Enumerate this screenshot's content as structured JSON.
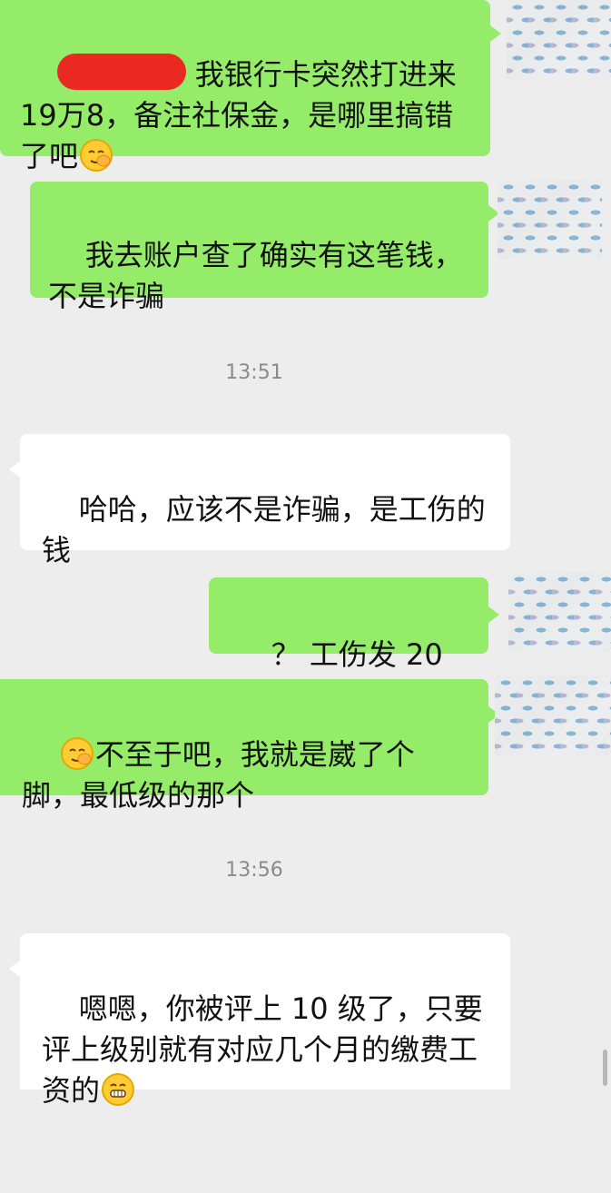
{
  "messages": [
    {
      "side": "out",
      "text_before": "",
      "text": "我银行卡突然打进来19万8，备注社保金，是哪里搞错了吧",
      "emoji": "facepalm-emoji"
    },
    {
      "side": "out",
      "text": "我去账户查了确实有这笔钱，不是诈骗"
    },
    {
      "type": "time",
      "text": "13:51"
    },
    {
      "side": "in",
      "text": "哈哈，应该不是诈骗，是工伤的钱"
    },
    {
      "side": "out",
      "text": "？ 工伤发 20 万？"
    },
    {
      "side": "out",
      "emoji_before": "facepalm-emoji",
      "text": "不至于吧，我就是崴了个脚，最低级的那个"
    },
    {
      "type": "time",
      "text": "13:56"
    },
    {
      "side": "in",
      "text": "嗯嗯，你被评上 10 级了，只要评上级别就有对应几个月的缴费工资的",
      "emoji": "grin-emoji"
    }
  ],
  "colors": {
    "background": "#ededed",
    "outgoing_bubble": "#95ec69",
    "incoming_bubble": "#ffffff",
    "redaction": "#ea2a22",
    "timestamp": "#8a8a8a"
  }
}
